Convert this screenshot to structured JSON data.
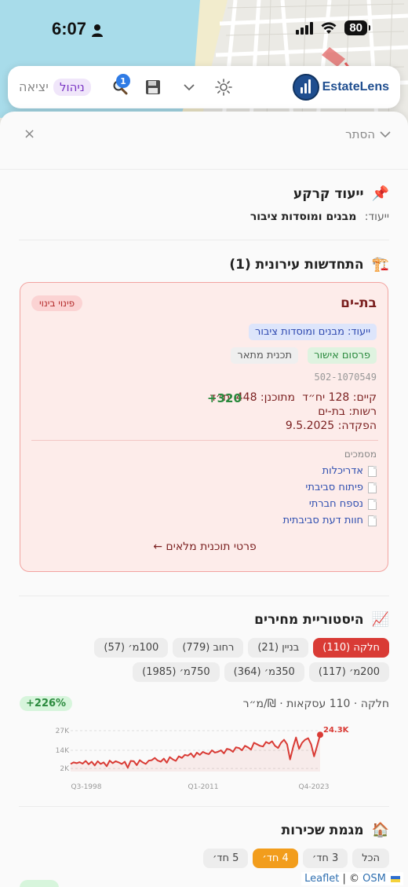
{
  "status_bar": {
    "time": "6:07",
    "battery": "80"
  },
  "toolbar": {
    "logo_text": "EstateLens",
    "search_badge": "1",
    "manage_label": "ניהול",
    "exit_label": "יציאה"
  },
  "panel": {
    "hide_label": "הסתר",
    "close_label": "×"
  },
  "zoning": {
    "title": "ייעוד קרקע",
    "label": "ייעוד:",
    "value": "מבנים ומוסדות ציבור"
  },
  "renewal": {
    "title": "התחדשות עירונית (1)",
    "plan": {
      "name": "בת-ים",
      "type_badge": "פינוי בינוי",
      "zoning_badge": "ייעוד: מבנים ומוסדות ציבור",
      "status_badge": "פרסום אישור",
      "plan_type": "תכנית מתאר",
      "plan_number": "502-1070549",
      "existing": "קיים: 128 יח״ד",
      "planned": "מתוכנן: 448 יח״ד",
      "delta": "+320",
      "authority": "רשות: בת-ים",
      "deposit": "הפקדה: 9.5.2025",
      "docs_title": "מסמכים",
      "docs": [
        "אדריכלות",
        "פיתוח סביבתי",
        "נספח חברתי",
        "חוות דעת סביבתית"
      ],
      "details_link": "פרטי תוכנית מלאים ←"
    }
  },
  "price_history": {
    "title": "היסטוריית מחירים",
    "chips": [
      {
        "label": "חלקה",
        "count": "(110)",
        "active": true
      },
      {
        "label": "בניין",
        "count": "(21)",
        "active": false
      },
      {
        "label": "רחוב",
        "count": "(779)",
        "active": false
      },
      {
        "label": "100מ׳",
        "count": "(57)",
        "active": false
      },
      {
        "label": "200מ׳",
        "count": "(117)",
        "active": false
      },
      {
        "label": "350מ׳",
        "count": "(364)",
        "active": false
      },
      {
        "label": "750מ׳",
        "count": "(1985)",
        "active": false
      }
    ],
    "meta": "חלקה · 110 עסקאות · ₪/מ״ר",
    "growth": "+226%"
  },
  "chart_data": {
    "type": "line",
    "x_ticks": [
      "Q3-1998",
      "Q1-2011",
      "Q4-2023"
    ],
    "y_ticks": [
      "2K",
      "14K",
      "27K"
    ],
    "ylim": [
      0,
      27000
    ],
    "last_label": "24.3K",
    "series": [
      {
        "values": [
          5000,
          6000,
          5500,
          6200,
          5200,
          7000,
          4800,
          6500,
          4000,
          6800,
          5000,
          6000,
          3500,
          7200,
          5500,
          6800,
          6000,
          5000,
          6500,
          2500,
          7000,
          6800,
          4200,
          7500,
          6000,
          5000,
          7200,
          7500,
          9000,
          7200,
          6500,
          8500,
          5800,
          9500,
          8000,
          7000,
          10000,
          9000,
          11000,
          10500,
          12000,
          9500,
          12500,
          11000,
          13000,
          12000,
          11500,
          14000,
          12500,
          13000,
          14000,
          12000,
          15000,
          14500,
          13000,
          16000,
          15500,
          14000,
          17000,
          16000,
          14500,
          19000,
          18000,
          17000,
          16500,
          19500,
          18500,
          20000,
          17000,
          15500,
          19000,
          21000,
          18000,
          8000,
          16000,
          22500,
          15000,
          19000,
          21000,
          22000,
          18000,
          10000,
          17000,
          24300
        ],
        "color": "#d93b35"
      }
    ]
  },
  "rentals": {
    "title": "מגמת שכירות",
    "chips": [
      {
        "label": "הכל",
        "active": false
      },
      {
        "label": "3 חד׳",
        "active": false
      },
      {
        "label": "4 חד׳",
        "active": true
      },
      {
        "label": "5 חד׳",
        "active": false
      }
    ]
  },
  "attribution": {
    "leaflet": "Leaflet",
    "sep": " | © ",
    "osm": "OSM"
  },
  "icons": {
    "zoning": "pushpin-icon",
    "renewal": "construction-crane-icon",
    "prices": "chart-increasing-icon",
    "rentals": "house-icon"
  }
}
